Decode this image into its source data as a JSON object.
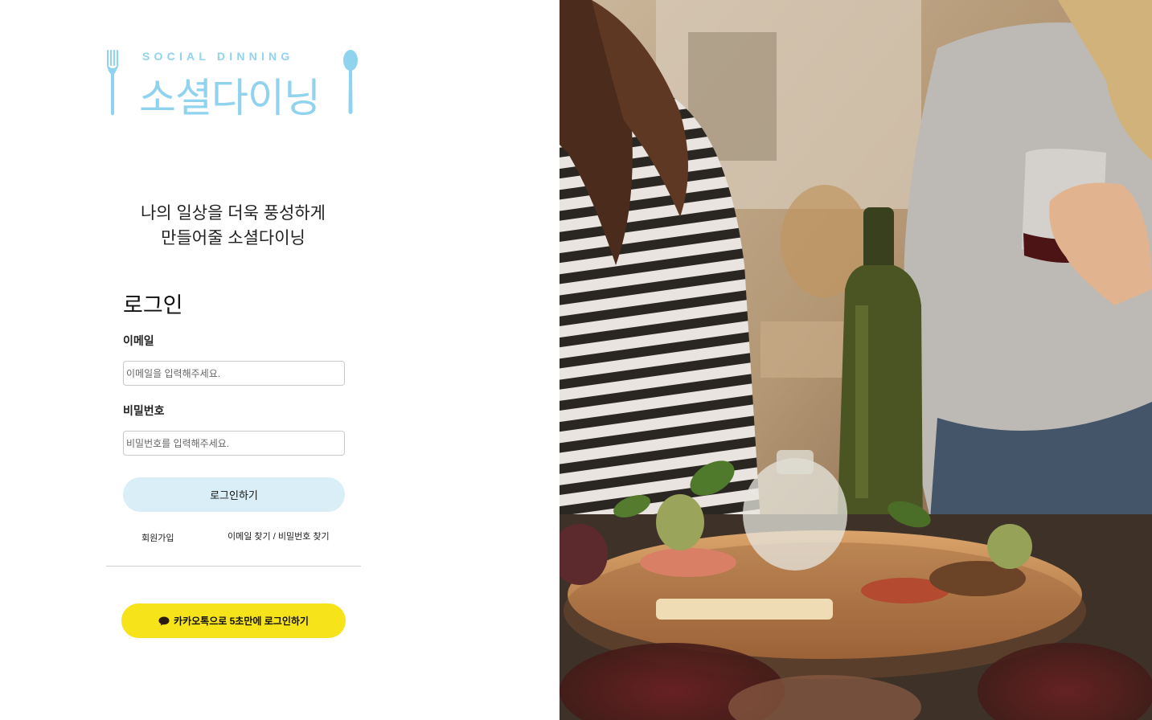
{
  "brand": {
    "logo_en": "SOCIAL DINNING",
    "logo_ko": "소셜다이닝",
    "logo_color": "#8fd3ef"
  },
  "tagline": {
    "line1": "나의 일상을 더욱 풍성하게",
    "line2": "만들어줄 소셜다이닝"
  },
  "login": {
    "title": "로그인",
    "email_label": "이메일",
    "email_placeholder": "이메일을 입력해주세요.",
    "email_value": "",
    "password_label": "비밀번호",
    "password_placeholder": "비밀번호를 입력해주세요.",
    "password_value": "",
    "submit_label": "로그인하기",
    "signup_link": "회원가입",
    "find_link": "이메일 찾기 / 비밀번호 찾기"
  },
  "kakao": {
    "label": "카카오톡으로 5초만에 로그인하기",
    "color": "#f7e319",
    "icon": "chat-bubble-icon"
  },
  "colors": {
    "login_button": "#d9eef7",
    "divider": "#cfcfcf"
  },
  "hero_image": {
    "icon": "photo-dinner-table"
  }
}
